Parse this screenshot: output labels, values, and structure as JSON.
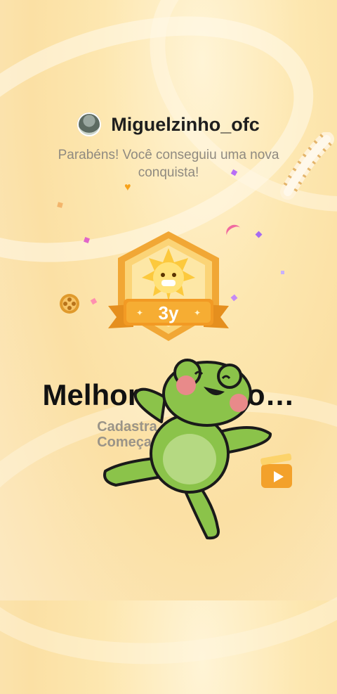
{
  "header": {
    "username": "Miguelzinho_ofc",
    "message": "Parabéns! Você conseguiu uma nova conquista!"
  },
  "badge": {
    "label": "3y",
    "icon": "sun-mascot-badge-icon"
  },
  "achievement": {
    "title": "Melhor",
    "title_visible_end": "do…",
    "description_line1": "Cadastra",
    "description_line2": "Começar"
  },
  "sticker": {
    "icon": "green-frog-sticker-icon"
  },
  "colors": {
    "accent": "#f5a623",
    "frog": "#8bc34a",
    "title": "#111111"
  }
}
